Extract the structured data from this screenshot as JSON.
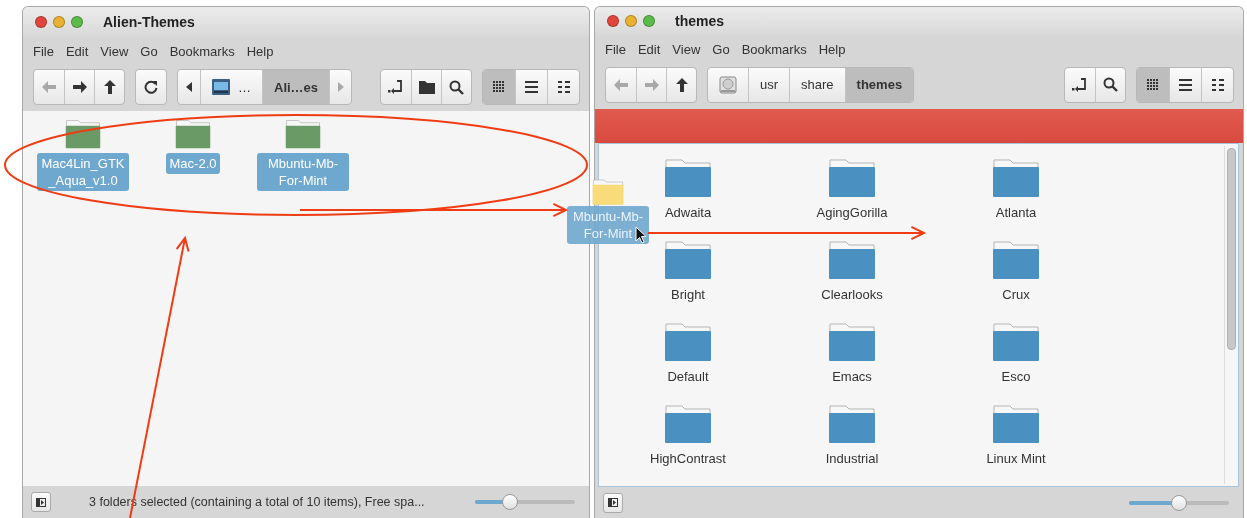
{
  "windows": [
    {
      "title": "Alien-Themes",
      "menu": [
        "File",
        "Edit",
        "View",
        "Go",
        "Bookmarks",
        "Help"
      ],
      "toolbar": [
        {
          "kind": "buttons",
          "buttons": [
            {
              "kind": "back",
              "disabled": true
            },
            {
              "kind": "forward",
              "disabled": false
            },
            {
              "kind": "up",
              "disabled": false
            }
          ]
        },
        {
          "kind": "buttons",
          "buttons": [
            {
              "kind": "reload",
              "disabled": false
            }
          ]
        },
        {
          "kind": "path",
          "items": [
            {
              "kind": "arrow-left",
              "disabled": false
            },
            {
              "kind": "computer-crumb",
              "label": "…",
              "selected": false
            },
            {
              "kind": "crumb",
              "label": "Ali…es",
              "selected": true
            },
            {
              "kind": "arrow-right",
              "disabled": true
            }
          ]
        },
        {
          "kind": "spacer"
        },
        {
          "kind": "buttons",
          "buttons": [
            {
              "kind": "location",
              "disabled": false
            },
            {
              "kind": "new-folder",
              "disabled": false
            },
            {
              "kind": "search",
              "disabled": false
            }
          ]
        },
        {
          "kind": "views",
          "buttons": [
            {
              "kind": "icons",
              "selected": true
            },
            {
              "kind": "list",
              "selected": false
            },
            {
              "kind": "compact",
              "selected": false
            }
          ]
        }
      ],
      "alert_bar": false,
      "scrollbar": false,
      "files": [
        {
          "name": "Mac4Lin_GTK_Aqua_v1.0",
          "selected": true,
          "color": "#6a9a66"
        },
        {
          "name": "Mac-2.0",
          "selected": true,
          "color": "#6a9a66"
        },
        {
          "name": "Mbuntu-Mb-For-Mint",
          "selected": true,
          "color": "#6a9a66"
        }
      ],
      "status": {
        "text": "3 folders selected (containing a total of 10 items), Free spa...",
        "level": 0.35
      }
    },
    {
      "title": "themes",
      "menu": [
        "File",
        "Edit",
        "View",
        "Go",
        "Bookmarks",
        "Help"
      ],
      "toolbar": [
        {
          "kind": "buttons",
          "buttons": [
            {
              "kind": "back",
              "disabled": true
            },
            {
              "kind": "forward",
              "disabled": true
            },
            {
              "kind": "up",
              "disabled": false
            }
          ]
        },
        {
          "kind": "path",
          "items": [
            {
              "kind": "drive-crumb",
              "selected": false
            },
            {
              "kind": "crumb",
              "label": "usr",
              "selected": false
            },
            {
              "kind": "crumb",
              "label": "share",
              "selected": false
            },
            {
              "kind": "crumb",
              "label": "themes",
              "selected": true
            }
          ]
        },
        {
          "kind": "spacer"
        },
        {
          "kind": "buttons",
          "buttons": [
            {
              "kind": "location",
              "disabled": false
            },
            {
              "kind": "search",
              "disabled": false
            }
          ]
        },
        {
          "kind": "views",
          "buttons": [
            {
              "kind": "icons",
              "selected": true
            },
            {
              "kind": "list",
              "selected": false
            },
            {
              "kind": "compact",
              "selected": false
            }
          ]
        }
      ],
      "alert_bar": true,
      "scrollbar": true,
      "files": [
        {
          "name": "Adwaita",
          "selected": false,
          "color": "#4a90c0"
        },
        {
          "name": "AgingGorilla",
          "selected": false,
          "color": "#4a90c0"
        },
        {
          "name": "Atlanta",
          "selected": false,
          "color": "#4a90c0"
        },
        {
          "name": "Bright",
          "selected": false,
          "color": "#4a90c0"
        },
        {
          "name": "Clearlooks",
          "selected": false,
          "color": "#4a90c0"
        },
        {
          "name": "Crux",
          "selected": false,
          "color": "#4a90c0"
        },
        {
          "name": "Default",
          "selected": false,
          "color": "#4a90c0"
        },
        {
          "name": "Emacs",
          "selected": false,
          "color": "#4a90c0"
        },
        {
          "name": "Esco",
          "selected": false,
          "color": "#4a90c0"
        },
        {
          "name": "HighContrast",
          "selected": false,
          "color": "#4a90c0"
        },
        {
          "name": "Industrial",
          "selected": false,
          "color": "#4a90c0"
        },
        {
          "name": "Linux Mint",
          "selected": false,
          "color": "#4a90c0"
        }
      ],
      "status": {
        "level": 0.5
      }
    }
  ],
  "drag": {
    "label": "Mbuntu-Mb-For-Mint"
  }
}
